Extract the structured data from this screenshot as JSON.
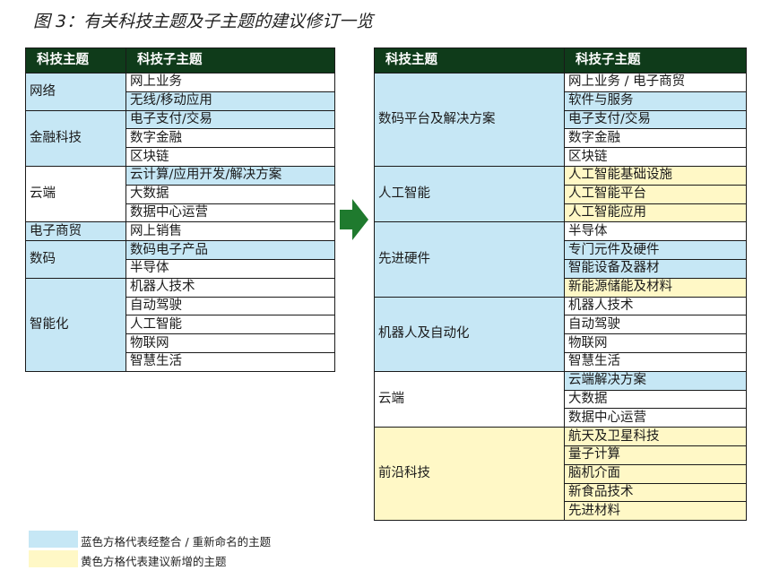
{
  "title": "图 3：有关科技主题及子主题的建议修订一览",
  "colors": {
    "header": "#0f3b1a",
    "blue": "#c6e7f5",
    "yellow": "#fff8c6",
    "arrow": "#1f7a2e"
  },
  "left_table": {
    "headers": [
      "科技主题",
      "科技子主题"
    ],
    "groups": [
      {
        "theme": "网络",
        "theme_color": "blue",
        "subs": [
          {
            "text": "网上业务",
            "color": "white"
          },
          {
            "text": "无线/移动应用",
            "color": "blue"
          }
        ]
      },
      {
        "theme": "金融科技",
        "theme_color": "blue",
        "subs": [
          {
            "text": "电子支付/交易",
            "color": "blue"
          },
          {
            "text": "数字金融",
            "color": "white"
          },
          {
            "text": "区块链",
            "color": "white"
          }
        ]
      },
      {
        "theme": "云端",
        "theme_color": "white",
        "subs": [
          {
            "text": "云计算/应用开发/解决方案",
            "color": "blue"
          },
          {
            "text": "大数据",
            "color": "white"
          },
          {
            "text": "数据中心运营",
            "color": "white"
          }
        ]
      },
      {
        "theme": "电子商贸",
        "theme_color": "blue",
        "subs": [
          {
            "text": "网上销售",
            "color": "white"
          }
        ]
      },
      {
        "theme": "数码",
        "theme_color": "blue",
        "subs": [
          {
            "text": "数码电子产品",
            "color": "blue"
          },
          {
            "text": "半导体",
            "color": "white"
          }
        ]
      },
      {
        "theme": "智能化",
        "theme_color": "blue",
        "subs": [
          {
            "text": "机器人技术",
            "color": "white"
          },
          {
            "text": "自动驾驶",
            "color": "white"
          },
          {
            "text": "人工智能",
            "color": "white"
          },
          {
            "text": "物联网",
            "color": "white"
          },
          {
            "text": "智慧生活",
            "color": "white"
          }
        ]
      }
    ]
  },
  "right_table": {
    "headers": [
      "科技主题",
      "科技子主题"
    ],
    "groups": [
      {
        "theme": "数码平台及解决方案",
        "theme_color": "blue",
        "subs": [
          {
            "text": "网上业务 / 电子商贸",
            "color": "white"
          },
          {
            "text": "软件与服务",
            "color": "blue"
          },
          {
            "text": "电子支付/交易",
            "color": "blue"
          },
          {
            "text": "数字金融",
            "color": "white"
          },
          {
            "text": "区块链",
            "color": "white"
          }
        ]
      },
      {
        "theme": "人工智能",
        "theme_color": "blue",
        "subs": [
          {
            "text": "人工智能基础设施",
            "color": "yellow"
          },
          {
            "text": "人工智能平台",
            "color": "yellow"
          },
          {
            "text": "人工智能应用",
            "color": "yellow"
          }
        ]
      },
      {
        "theme": "先进硬件",
        "theme_color": "blue",
        "subs": [
          {
            "text": "半导体",
            "color": "white"
          },
          {
            "text": "专门元件及硬件",
            "color": "blue"
          },
          {
            "text": "智能设备及器材",
            "color": "blue"
          },
          {
            "text": "新能源储能及材料",
            "color": "yellow"
          }
        ]
      },
      {
        "theme": "机器人及自动化",
        "theme_color": "blue",
        "subs": [
          {
            "text": "机器人技术",
            "color": "white"
          },
          {
            "text": "自动驾驶",
            "color": "white"
          },
          {
            "text": "物联网",
            "color": "white"
          },
          {
            "text": "智慧生活",
            "color": "white"
          }
        ]
      },
      {
        "theme": "云端",
        "theme_color": "white",
        "subs": [
          {
            "text": "云端解决方案",
            "color": "blue"
          },
          {
            "text": "大数据",
            "color": "white"
          },
          {
            "text": "数据中心运营",
            "color": "white"
          }
        ]
      },
      {
        "theme": "前沿科技",
        "theme_color": "yellow",
        "subs": [
          {
            "text": "航天及卫星科技",
            "color": "yellow"
          },
          {
            "text": "量子计算",
            "color": "yellow"
          },
          {
            "text": "脑机介面",
            "color": "yellow"
          },
          {
            "text": "新食品技术",
            "color": "yellow"
          },
          {
            "text": "先进材料",
            "color": "yellow"
          }
        ]
      }
    ]
  },
  "legend": [
    {
      "color": "blue",
      "label": "蓝色方格代表经整合 / 重新命名的主题"
    },
    {
      "color": "yellow",
      "label": "黄色方格代表建议新增的主题"
    }
  ],
  "icons": {
    "arrow": "right-arrow-icon"
  }
}
